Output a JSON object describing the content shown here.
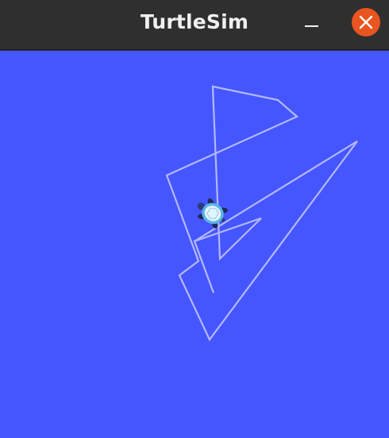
{
  "window": {
    "title": "TurtleSim"
  },
  "controls": {
    "minimize_icon": "minimize-icon",
    "close_icon": "close-icon"
  },
  "canvas": {
    "background": "#4556ff",
    "pen_color": "#b3b8ff"
  },
  "turtle": {
    "icon": "turtle-icon"
  }
}
